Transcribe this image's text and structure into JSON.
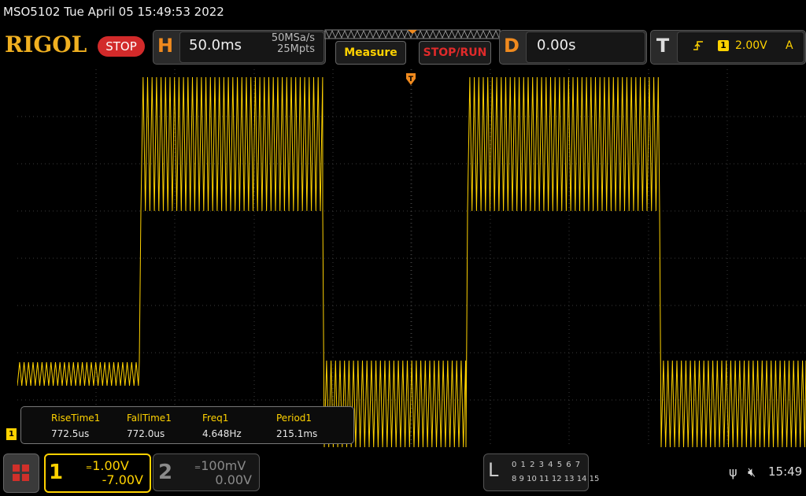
{
  "title": {
    "datetime": "MSO5102  Tue April 05 15:49:53 2022"
  },
  "brand": "RIGOL",
  "run_state": "STOP",
  "horizontal": {
    "key": "H",
    "timebase": "50.0ms",
    "sample_rate": "50MSa/s",
    "memory_depth": "25Mpts"
  },
  "buttons": {
    "measure": "Measure",
    "stop_run": "STOP/RUN"
  },
  "delay": {
    "key": "D",
    "value": "0.00s"
  },
  "trigger": {
    "key": "T",
    "source": "1",
    "level": "2.00V",
    "mode": "A"
  },
  "measurements": [
    {
      "label": "RiseTime1",
      "value": "772.5us"
    },
    {
      "label": "FallTime1",
      "value": "772.0us"
    },
    {
      "label": "Freq1",
      "value": "4.648Hz"
    },
    {
      "label": "Period1",
      "value": "215.1ms"
    }
  ],
  "channel1": {
    "number": "1",
    "scale": "1.00V",
    "offset": "-7.00V",
    "color": "#ffd200",
    "ground_marker": "1"
  },
  "channel2": {
    "number": "2",
    "scale": "100mV",
    "offset": "0.00V",
    "color": "#8a8a8a"
  },
  "logic": {
    "key": "L",
    "row1": "0 1 2 3   4 5 6 7",
    "row2": "8 9 10 11  12 13 14 15"
  },
  "status": {
    "clock": "15:49",
    "usb_icon": "usb-icon",
    "volume_icon": "mute-icon"
  },
  "colors": {
    "accent_orange": "#f08a1e",
    "waveform": "#ffd200",
    "stop_red": "#d22a2a",
    "grid": "#3c3c3c"
  }
}
